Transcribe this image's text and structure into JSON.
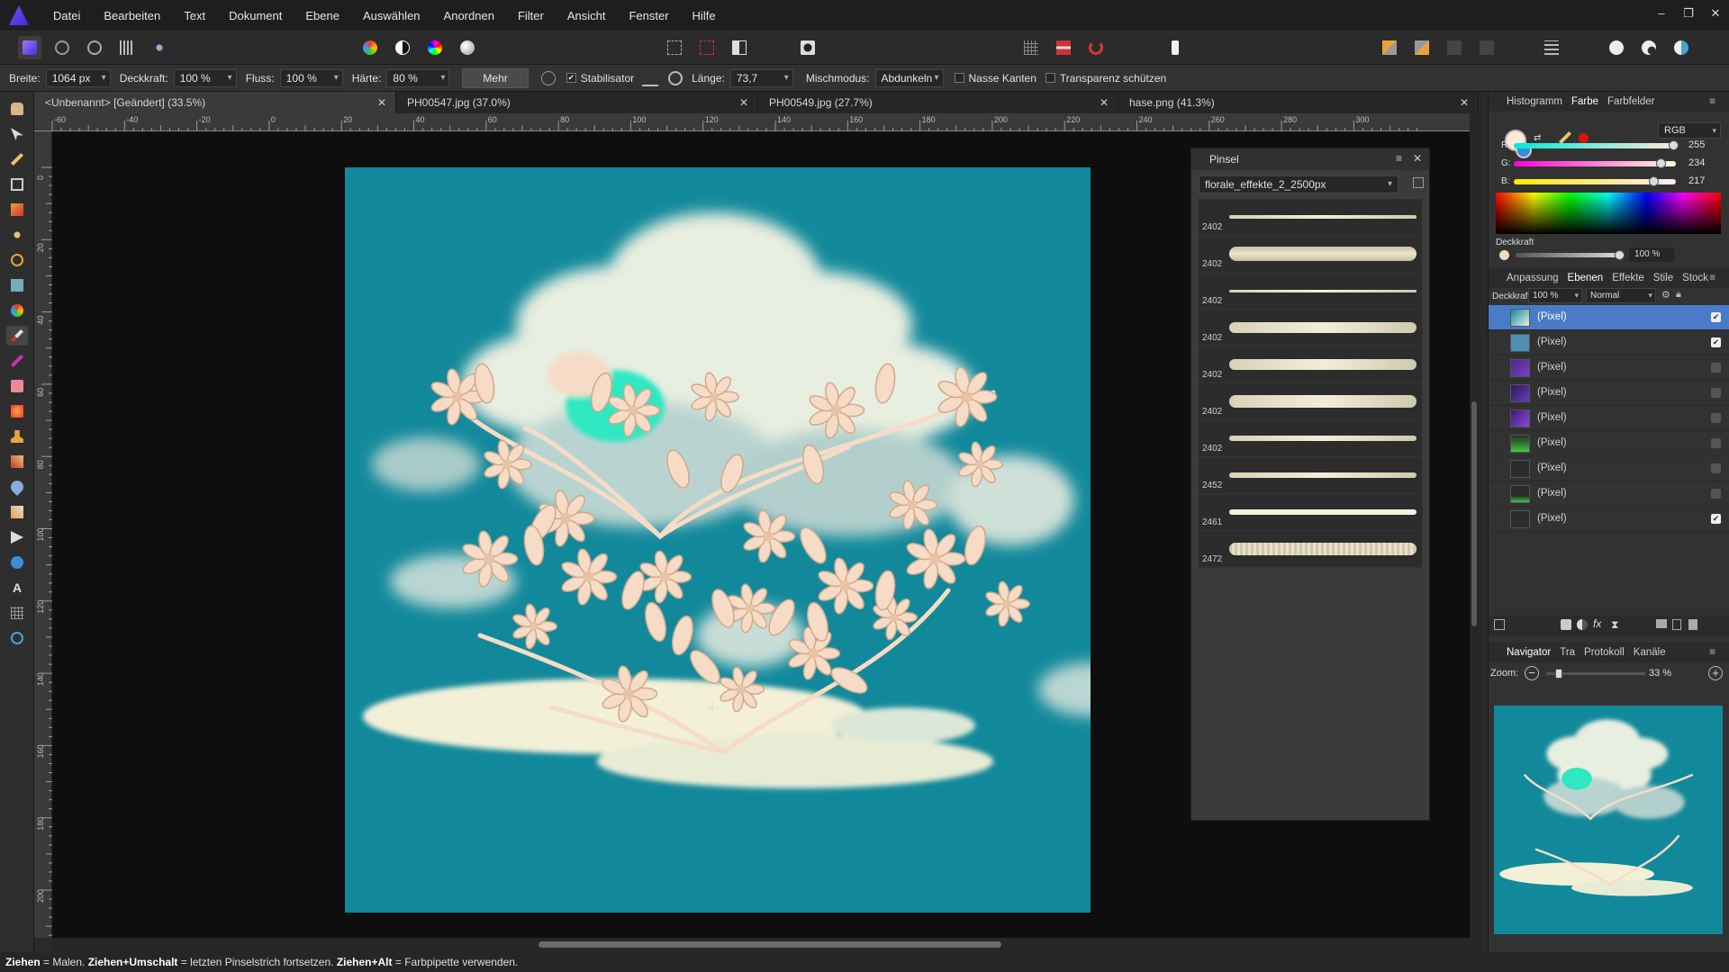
{
  "menu": [
    "Datei",
    "Bearbeiten",
    "Text",
    "Dokument",
    "Ebene",
    "Auswählen",
    "Anordnen",
    "Filter",
    "Ansicht",
    "Fenster",
    "Hilfe"
  ],
  "ctx": {
    "breite_label": "Breite:",
    "breite_value": "1064 px",
    "deckkraft_label": "Deckkraft:",
    "deckkraft_value": "100 %",
    "fluss_label": "Fluss:",
    "fluss_value": "100 %",
    "haerte_label": "Härte:",
    "haerte_value": "80 %",
    "mehr_label": "Mehr",
    "stabilisator_label": "Stabilisator",
    "laenge_label": "Länge:",
    "laenge_value": "73,7",
    "mischmodus_label": "Mischmodus:",
    "mischmodus_value": "Abdunkeln",
    "nasse_label": "Nasse Kanten",
    "transparenz_label": "Transparenz schützen"
  },
  "doc_tabs": [
    "<Unbenannt> [Geändert] (33.5%)",
    "PH00547.jpg (37.0%)",
    "PH00549.jpg (27.7%)",
    "hase.png (41.3%)"
  ],
  "ruler_top": [
    "-60",
    "-40",
    "-20",
    "0",
    "20",
    "40",
    "60",
    "80",
    "100",
    "120",
    "140",
    "160",
    "180",
    "200",
    "220",
    "240",
    "260",
    "280",
    "300"
  ],
  "ruler_left": [
    "0",
    "20",
    "40",
    "60",
    "80",
    "100",
    "120",
    "140",
    "160",
    "180",
    "200"
  ],
  "brush_panel": {
    "title": "Pinsel",
    "category": "florale_effekte_2_2500px",
    "brushes": [
      "2402",
      "2402",
      "2402",
      "2402",
      "2402",
      "2402",
      "2402",
      "2452",
      "2461",
      "2472"
    ]
  },
  "color_panel": {
    "tabs": [
      "Histogramm",
      "Farbe",
      "Farbfelder"
    ],
    "model": "RGB",
    "r_label": "R:",
    "r_value": "255",
    "g_label": "G:",
    "g_value": "234",
    "b_label": "B:",
    "b_value": "217",
    "opacity_label": "Deckkraft",
    "opacity_value": "100 %",
    "fill_color": "#ffead9"
  },
  "layers_panel": {
    "tabs": [
      "Anpassung",
      "Ebenen",
      "Effekte",
      "Stile",
      "Stock"
    ],
    "opacity_label": "Deckkraft:",
    "opacity_value": "100 %",
    "blend_mode": "Normal",
    "layers": [
      "(Pixel)",
      "(Pixel)",
      "(Pixel)",
      "(Pixel)",
      "(Pixel)",
      "(Pixel)",
      "(Pixel)",
      "(Pixel)",
      "(Pixel)"
    ]
  },
  "navigator": {
    "tabs": [
      "Navigator",
      "Tra",
      "Protokoll",
      "Kanäle"
    ],
    "zoom_label": "Zoom:",
    "zoom_value": "33 %"
  },
  "status": {
    "k1": "Ziehen",
    "t1": " = Malen. ",
    "k2": "Ziehen+Umschalt",
    "t2": " = letzten Pinselstrich fortsetzen. ",
    "k3": "Ziehen+Alt",
    "t3": " = Farbpipette verwenden."
  }
}
